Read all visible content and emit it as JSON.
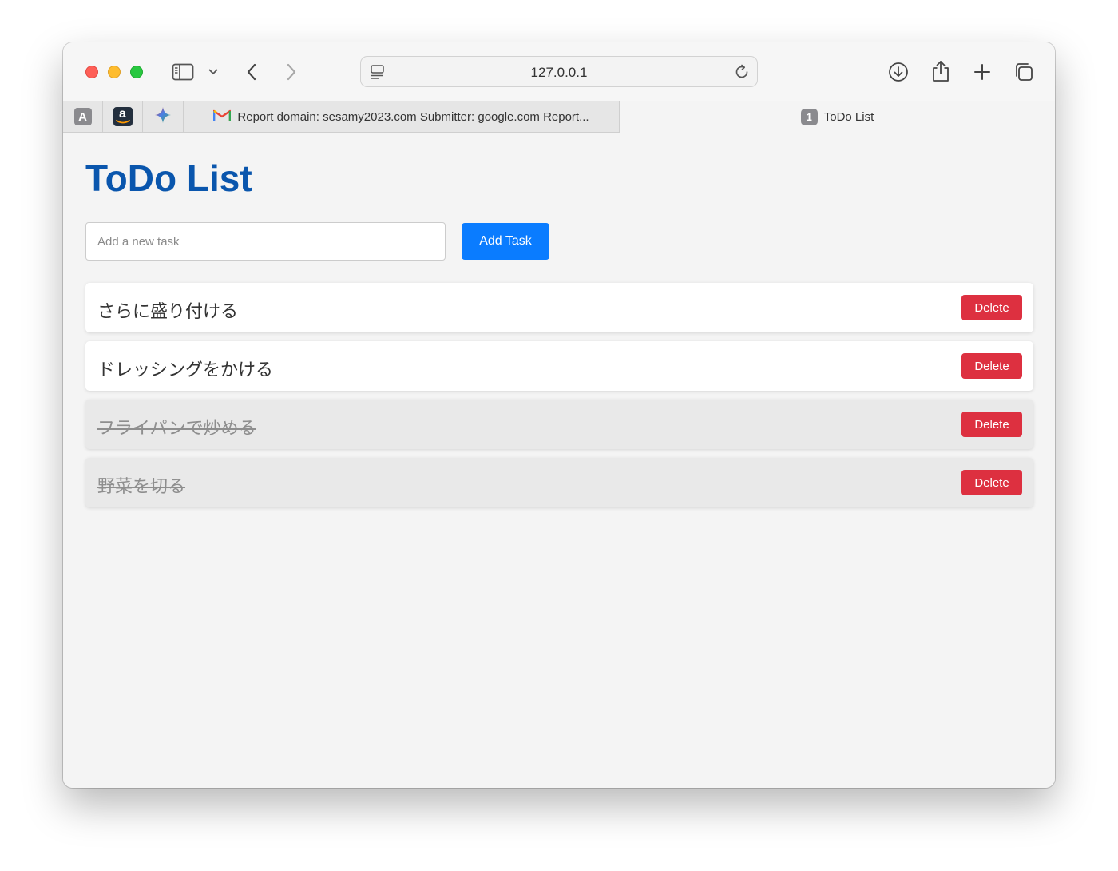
{
  "browser": {
    "url": "127.0.0.1",
    "icons": {
      "sidebar": "sidebar-icon",
      "chevron": "chevron-down-icon",
      "back": "back-arrow-icon",
      "forward": "forward-arrow-icon",
      "page_menu": "page-menu-icon",
      "reload": "reload-icon",
      "download": "download-icon",
      "share": "share-icon",
      "new_tab": "plus-icon",
      "tab_overview": "tab-overview-icon"
    },
    "pinned_tabs": [
      {
        "icon": "font-a-icon",
        "label": "A"
      },
      {
        "icon": "amazon-icon",
        "label": "a"
      },
      {
        "icon": "gemini-sparkle-icon",
        "label": ""
      }
    ],
    "tabs": [
      {
        "label": "Report domain: sesamy2023.com Submitter: google.com Report...",
        "icon": "gmail-icon"
      },
      {
        "label": "ToDo List",
        "badge": "1",
        "active": true
      }
    ]
  },
  "app": {
    "title": "ToDo List",
    "input_placeholder": "Add a new task",
    "input_value": "",
    "add_button_label": "Add Task",
    "delete_label": "Delete",
    "colors": {
      "title": "#0a56ad",
      "add_button": "#0a7cff",
      "delete_button": "#dd3040"
    },
    "tasks": [
      {
        "text": "さらに盛り付ける",
        "completed": false
      },
      {
        "text": "ドレッシングをかける",
        "completed": false
      },
      {
        "text": "フライパンで炒める",
        "completed": true
      },
      {
        "text": "野菜を切る",
        "completed": true
      }
    ]
  }
}
